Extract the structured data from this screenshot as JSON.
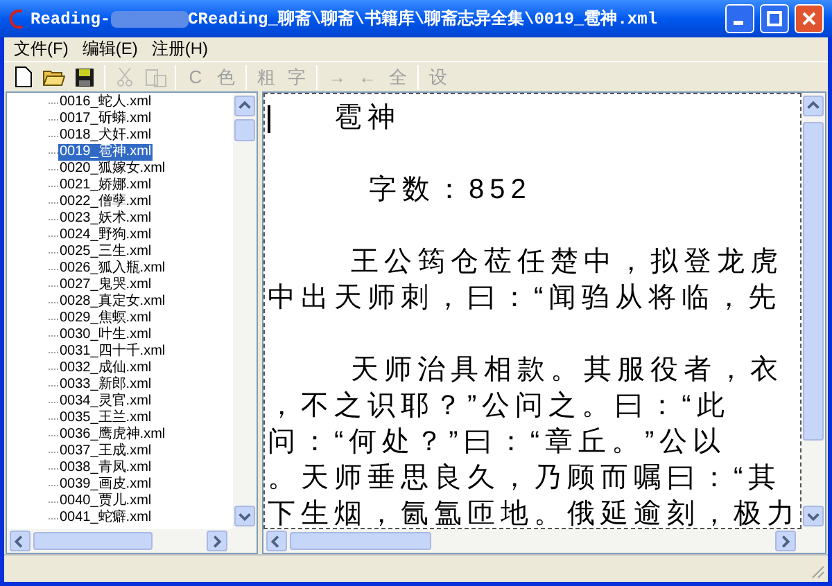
{
  "window": {
    "title_prefix": "Reading-",
    "title_suffix": "CReading_聊斋\\聊斋\\书籍库\\聊斋志异全集\\0019_雹神.xml"
  },
  "menu": [
    "文件(F)",
    "编辑(E)",
    "注册(H)"
  ],
  "toolbar": [
    {
      "kind": "new",
      "disabled": false
    },
    {
      "kind": "open",
      "disabled": false
    },
    {
      "kind": "save",
      "disabled": false
    },
    {
      "kind": "sep"
    },
    {
      "kind": "cut",
      "disabled": true
    },
    {
      "kind": "paste",
      "disabled": true
    },
    {
      "kind": "sep"
    },
    {
      "kind": "char",
      "label": "C",
      "disabled": true
    },
    {
      "kind": "char",
      "label": "色",
      "disabled": true
    },
    {
      "kind": "sep"
    },
    {
      "kind": "char",
      "label": "粗",
      "disabled": true
    },
    {
      "kind": "char",
      "label": "字",
      "disabled": true
    },
    {
      "kind": "sep"
    },
    {
      "kind": "char",
      "label": "→",
      "disabled": true
    },
    {
      "kind": "char",
      "label": "←",
      "disabled": true
    },
    {
      "kind": "char",
      "label": "全",
      "disabled": true
    },
    {
      "kind": "sep"
    },
    {
      "kind": "char",
      "label": "设",
      "disabled": true
    }
  ],
  "tree": [
    {
      "label": "0016_蛇人.xml",
      "selected": false
    },
    {
      "label": "0017_斫蟒.xml",
      "selected": false
    },
    {
      "label": "0018_犬奸.xml",
      "selected": false
    },
    {
      "label": "0019_雹神.xml",
      "selected": true
    },
    {
      "label": "0020_狐嫁女.xml",
      "selected": false
    },
    {
      "label": "0021_娇娜.xml",
      "selected": false
    },
    {
      "label": "0022_僧孽.xml",
      "selected": false
    },
    {
      "label": "0023_妖术.xml",
      "selected": false
    },
    {
      "label": "0024_野狗.xml",
      "selected": false
    },
    {
      "label": "0025_三生.xml",
      "selected": false
    },
    {
      "label": "0026_狐入瓶.xml",
      "selected": false
    },
    {
      "label": "0027_鬼哭.xml",
      "selected": false
    },
    {
      "label": "0028_真定女.xml",
      "selected": false
    },
    {
      "label": "0029_焦螟.xml",
      "selected": false
    },
    {
      "label": "0030_叶生.xml",
      "selected": false
    },
    {
      "label": "0031_四十千.xml",
      "selected": false
    },
    {
      "label": "0032_成仙.xml",
      "selected": false
    },
    {
      "label": "0033_新郎.xml",
      "selected": false
    },
    {
      "label": "0034_灵官.xml",
      "selected": false
    },
    {
      "label": "0035_王兰.xml",
      "selected": false
    },
    {
      "label": "0036_鹰虎神.xml",
      "selected": false
    },
    {
      "label": "0037_王成.xml",
      "selected": false
    },
    {
      "label": "0038_青凤.xml",
      "selected": false
    },
    {
      "label": "0039_画皮.xml",
      "selected": false
    },
    {
      "label": "0040_贾儿.xml",
      "selected": false
    },
    {
      "label": "0041_蛇癖.xml",
      "selected": false
    }
  ],
  "document": [
    {
      "kind": "title",
      "text": "雹神"
    },
    {
      "kind": "blank"
    },
    {
      "kind": "count",
      "text": "字数：852"
    },
    {
      "kind": "blank"
    },
    {
      "kind": "indent",
      "text": "王公筠仓莅任楚中，拟登龙虎"
    },
    {
      "kind": "plain",
      "text": "中出天师刺，曰：“闻驺从将临，先"
    },
    {
      "kind": "blank"
    },
    {
      "kind": "indent",
      "text": "天师治具相款。其服役者，衣"
    },
    {
      "kind": "plain",
      "text": "，不之识耶？”公问之。曰：“此"
    },
    {
      "kind": "plain",
      "text": "问：“何处？”曰：“章丘。”公以"
    },
    {
      "kind": "plain",
      "text": "。天师垂思良久，乃顾而嘱曰：“其"
    },
    {
      "kind": "plain",
      "text": "下生烟，氤氲匝地。俄延逾刻，极力"
    }
  ]
}
